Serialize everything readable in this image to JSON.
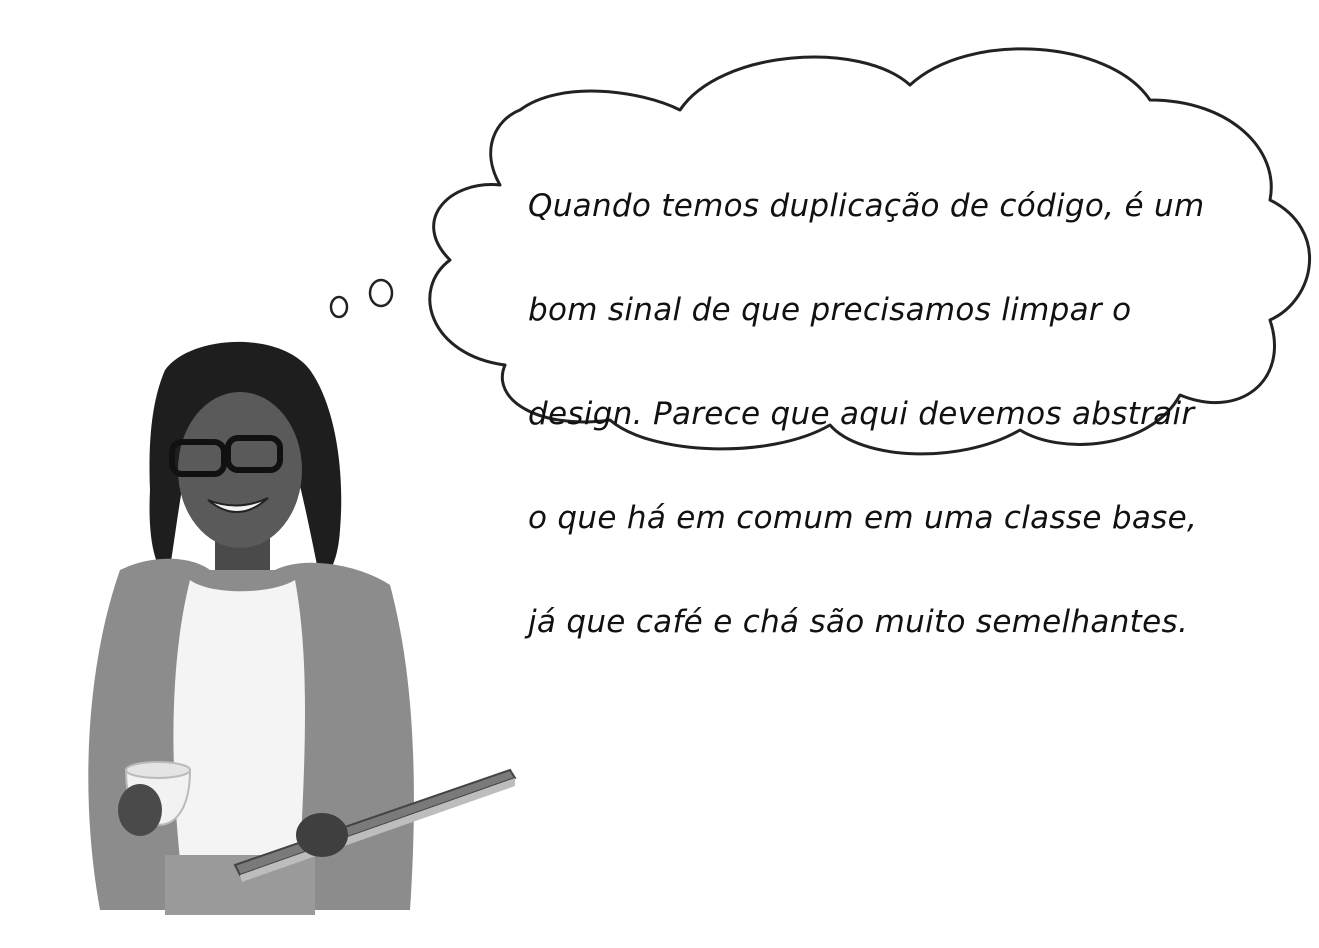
{
  "thought_bubble": {
    "lines": [
      "Quando temos duplicação de código, é um",
      "bom sinal de que precisamos limpar o",
      "design. Parece que aqui devemos abstrair",
      "o que há em comum em uma classe base,",
      "já que café e chá são muito semelhantes."
    ]
  },
  "illustration": {
    "subject": "woman-with-glasses-holding-coffee-cup-and-notebook",
    "style": "grayscale-photo"
  },
  "colors": {
    "background": "#ffffff",
    "outline": "#222222",
    "text": "#111111"
  }
}
